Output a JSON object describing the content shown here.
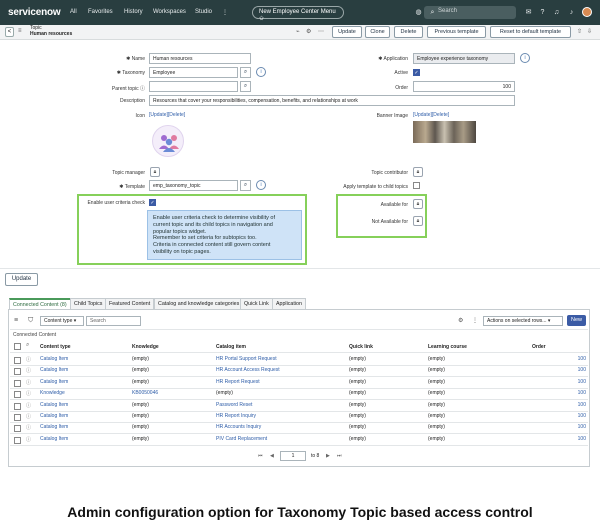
{
  "nav": {
    "logo": "servicenow",
    "links": [
      "All",
      "Favorites",
      "History",
      "Workspaces",
      "Studio"
    ],
    "more": "⋮",
    "menu_pill": "New Employee Center Menu ✩",
    "search_placeholder": "Search"
  },
  "header": {
    "back": "<",
    "title_top": "Topic",
    "title_bottom": "Human resources",
    "buttons": [
      "Update",
      "Clone",
      "Delete",
      "Previous template",
      "Reset to default template"
    ]
  },
  "form": {
    "name_label": "Name",
    "name_value": "Human resources",
    "taxonomy_label": "Taxonomy",
    "taxonomy_value": "Employee",
    "parent_label": "Parent topic",
    "parent_value": "",
    "description_label": "Description",
    "description_value": "Resources that cover your responsibilities, compensation, benefits, and relationships at work",
    "icon_label": "Icon",
    "icon_links": "[Update][Delete]",
    "application_label": "Application",
    "application_value": "Employee experience taxonomy",
    "active_label": "Active",
    "order_label": "Order",
    "order_value": "100",
    "banner_label": "Banner Image",
    "banner_links": "[Update][Delete]",
    "topic_manager_label": "Topic manager",
    "template_label": "Template",
    "template_value": "emp_taxonomy_topic",
    "topic_contributor_label": "Topic contributor",
    "apply_template_label": "Apply template to child topics",
    "enable_label": "Enable user criteria check",
    "available_label": "Available for",
    "not_available_label": "Not Available for",
    "tooltip": [
      "Enable user criteria check to determine visibility of",
      "current topic and its child topics in navigation and",
      "popular topics widget.",
      "Remember to set criteria for subtopics too.",
      "Criteria in connected content still govern content",
      "visibility on topic pages."
    ]
  },
  "lower": {
    "update": "Update",
    "tabs": [
      "Connected Content (8)",
      "Child Topics",
      "Featured Content",
      "Catalog and knowledge categories",
      "Quick Link",
      "Application"
    ],
    "filter_select": "Content type",
    "search_placeholder": "Search",
    "actions": "Actions on selected rows...",
    "new": "New",
    "section_title": "Connected Content",
    "columns": [
      "Content type",
      "Knowledge",
      "Catalog item",
      "Quick link",
      "Learning course",
      "Order"
    ],
    "rows": [
      [
        "Catalog Item",
        "(empty)",
        "HR Portal Support Request",
        "(empty)",
        "(empty)",
        "100"
      ],
      [
        "Catalog Item",
        "(empty)",
        "HR Account Access Request",
        "(empty)",
        "(empty)",
        "100"
      ],
      [
        "Catalog Item",
        "(empty)",
        "HR Report Request",
        "(empty)",
        "(empty)",
        "100"
      ],
      [
        "Knowledge",
        "KB0050046",
        "(empty)",
        "(empty)",
        "(empty)",
        "100"
      ],
      [
        "Catalog Item",
        "(empty)",
        "Password Reset",
        "(empty)",
        "(empty)",
        "100"
      ],
      [
        "Catalog Item",
        "(empty)",
        "HR Report Inquiry",
        "(empty)",
        "(empty)",
        "100"
      ],
      [
        "Catalog Item",
        "(empty)",
        "HR Accounts Inquiry",
        "(empty)",
        "(empty)",
        "100"
      ],
      [
        "Catalog Item",
        "(empty)",
        "PIV Card Replacement",
        "(empty)",
        "(empty)",
        "100"
      ]
    ],
    "pager_current": "1",
    "pager_total": "to 8"
  },
  "caption": "Admin configuration option for Taxonomy Topic based access control"
}
